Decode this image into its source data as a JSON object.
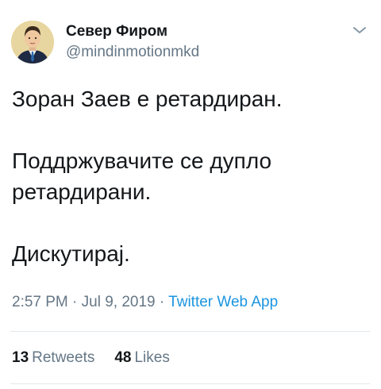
{
  "user": {
    "display_name": "Север Фиром",
    "handle": "@mindinmotionmkd"
  },
  "tweet": {
    "lines": [
      "Зоран Заев е ретардиран.",
      "",
      "Поддржувачите се дупло",
      "ретардирани.",
      "",
      "Дискутирај."
    ],
    "time": "2:57 PM",
    "separator1": " · ",
    "date": "Jul 9, 2019",
    "separator2": " · ",
    "source": "Twitter Web App"
  },
  "stats": {
    "retweets_count": "13",
    "retweets_label": "Retweets",
    "likes_count": "48",
    "likes_label": "Likes"
  },
  "icons": {
    "menu": "chevron-down-icon"
  },
  "colors": {
    "text": "#14171a",
    "secondary": "#657786",
    "link": "#1b95e0",
    "divider": "#e1e8ed"
  }
}
